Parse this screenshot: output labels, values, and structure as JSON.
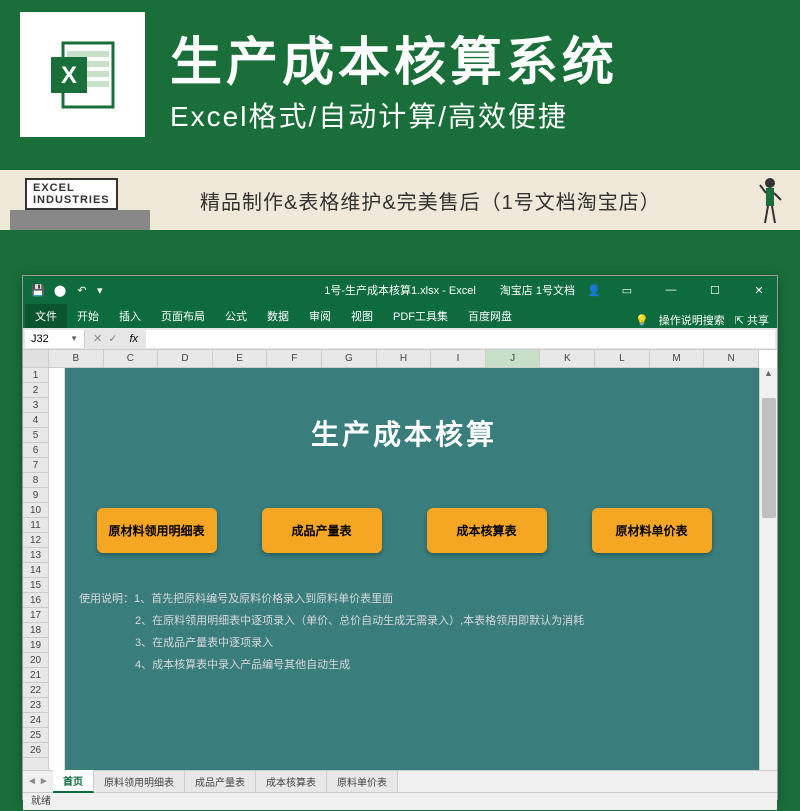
{
  "banner": {
    "title": "生产成本核算系统",
    "subtitle": "Excel格式/自动计算/高效便捷",
    "industries_label": "EXCEL\nINDUSTRIES",
    "strip_text": "精品制作&表格维护&完美售后（1号文档淘宝店）"
  },
  "titlebar": {
    "doc_title": "1号-生产成本核算1.xlsx - Excel",
    "shop": "淘宝店 1号文档",
    "autosave_icon": "autosave"
  },
  "ribbon": {
    "file": "文件",
    "tabs": [
      "开始",
      "插入",
      "页面布局",
      "公式",
      "数据",
      "审阅",
      "视图",
      "PDF工具集",
      "百度网盘"
    ],
    "help": "操作说明搜索",
    "share": "共享"
  },
  "formula": {
    "name_box": "J32",
    "fx": "fx"
  },
  "columns": [
    "B",
    "C",
    "D",
    "E",
    "F",
    "G",
    "H",
    "I",
    "J",
    "K",
    "L",
    "M",
    "N"
  ],
  "selected_col": "J",
  "rows": [
    "1",
    "2",
    "3",
    "4",
    "5",
    "6",
    "7",
    "8",
    "9",
    "10",
    "11",
    "12",
    "13",
    "14",
    "15",
    "16",
    "17",
    "18",
    "19",
    "20",
    "21",
    "22",
    "23",
    "24",
    "25",
    "26"
  ],
  "sheet": {
    "title": "生产成本核算",
    "buttons": [
      "原材料领用明细表",
      "成品产量表",
      "成本核算表",
      "原材料单价表"
    ],
    "inst_label": "使用说明：",
    "instructions": [
      "1、首先把原料编号及原料价格录入到原料单价表里面",
      "2、在原料领用明细表中逐项录入（单价、总价自动生成无需录入）,本表格领用即默认为消耗",
      "3、在成品产量表中逐项录入",
      "4、成本核算表中录入产品编号其他自动生成"
    ]
  },
  "sheet_tabs": [
    "首页",
    "原料领用明细表",
    "成品产量表",
    "成本核算表",
    "原料单价表"
  ],
  "active_tab": "首页",
  "status": "就绪"
}
